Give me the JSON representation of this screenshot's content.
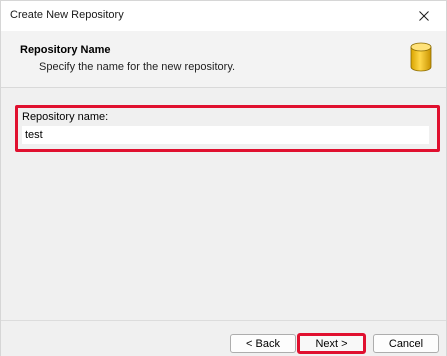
{
  "window": {
    "title": "Create New Repository"
  },
  "header": {
    "title": "Repository Name",
    "subtitle": "Specify the name for the new repository.",
    "icon": "database-icon"
  },
  "form": {
    "repository_name_label": "Repository name:",
    "repository_name_value": "test"
  },
  "buttons": {
    "back": "< Back",
    "next": "Next >",
    "cancel": "Cancel"
  },
  "colors": {
    "highlight": "#e0102f",
    "icon_fill": "#f5c400"
  }
}
